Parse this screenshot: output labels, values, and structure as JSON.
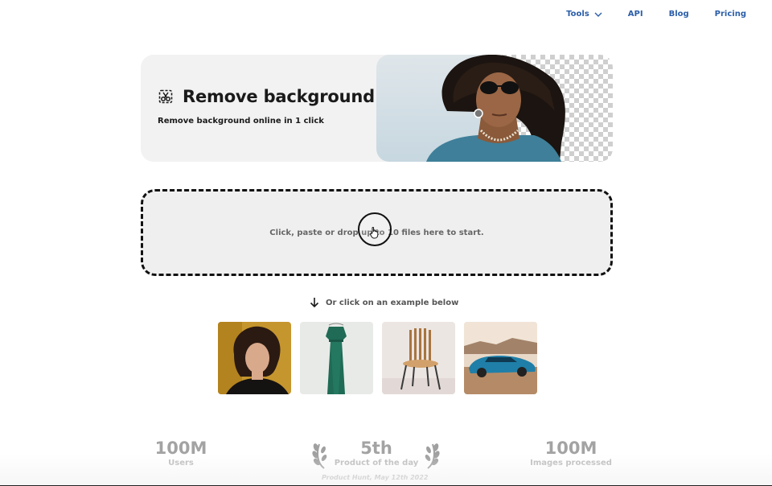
{
  "nav": {
    "tools": "Tools",
    "api": "API",
    "blog": "Blog",
    "pricing": "Pricing"
  },
  "hero": {
    "title": "Remove background",
    "subtitle": "Remove background online in 1 click"
  },
  "dropzone": {
    "text": "Click, paste or drop up to 10 files here to start."
  },
  "examples": {
    "hint": "Or click on an example below",
    "items": [
      "woman-portrait",
      "green-dress",
      "wooden-chair",
      "blue-car"
    ]
  },
  "stats": {
    "users_value": "100M",
    "users_label": "Users",
    "rank_value": "5th",
    "rank_label": "Product of the day",
    "rank_source": "Product Hunt, May 12th 2022",
    "images_value": "100M",
    "images_label": "Images processed"
  },
  "colors": {
    "link": "#2b5ea8",
    "hero_bg": "#f2f2f2",
    "dropzone_bg": "#efefef"
  }
}
